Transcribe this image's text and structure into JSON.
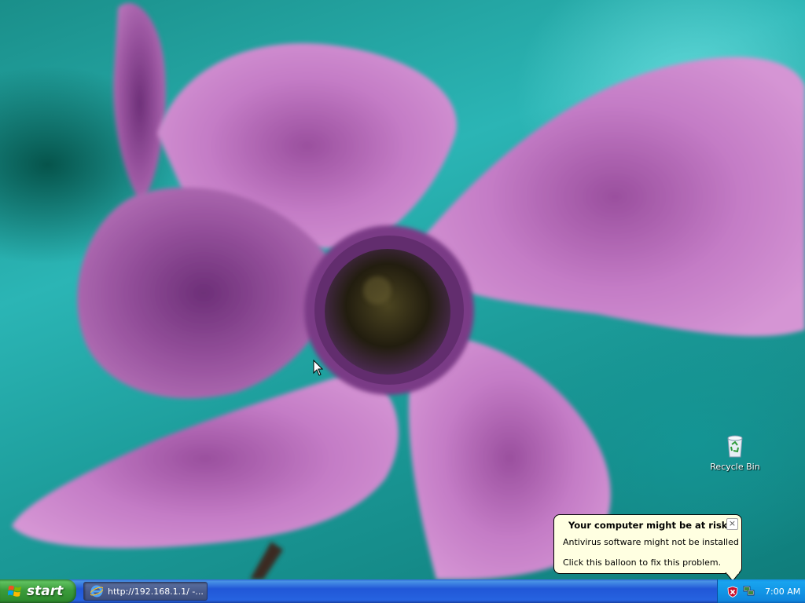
{
  "desktop": {
    "icons": [
      {
        "label": "Recycle Bin",
        "icon": "recycle-bin-icon"
      }
    ]
  },
  "balloon": {
    "title": "Your computer might be at risk",
    "line1": "Antivirus software might not be installed",
    "line2": "Click this balloon to fix this problem.",
    "icon": "security-shield-icon",
    "close_glyph": "×"
  },
  "taskbar": {
    "start_label": "start",
    "task_button_label": "http://192.168.1.1/ -...",
    "task_button_icon": "internet-explorer-icon",
    "tray_icons": [
      "security-alert-icon",
      "network-icon"
    ],
    "clock": "7:00 AM"
  },
  "colors": {
    "taskbar_blue": "#2157d7",
    "start_green": "#3b9c3b",
    "tray_blue": "#1296e6",
    "balloon_bg": "#ffffe1",
    "petal_pink": "#c779c8",
    "wallpaper_teal": "#2bb5b5"
  }
}
